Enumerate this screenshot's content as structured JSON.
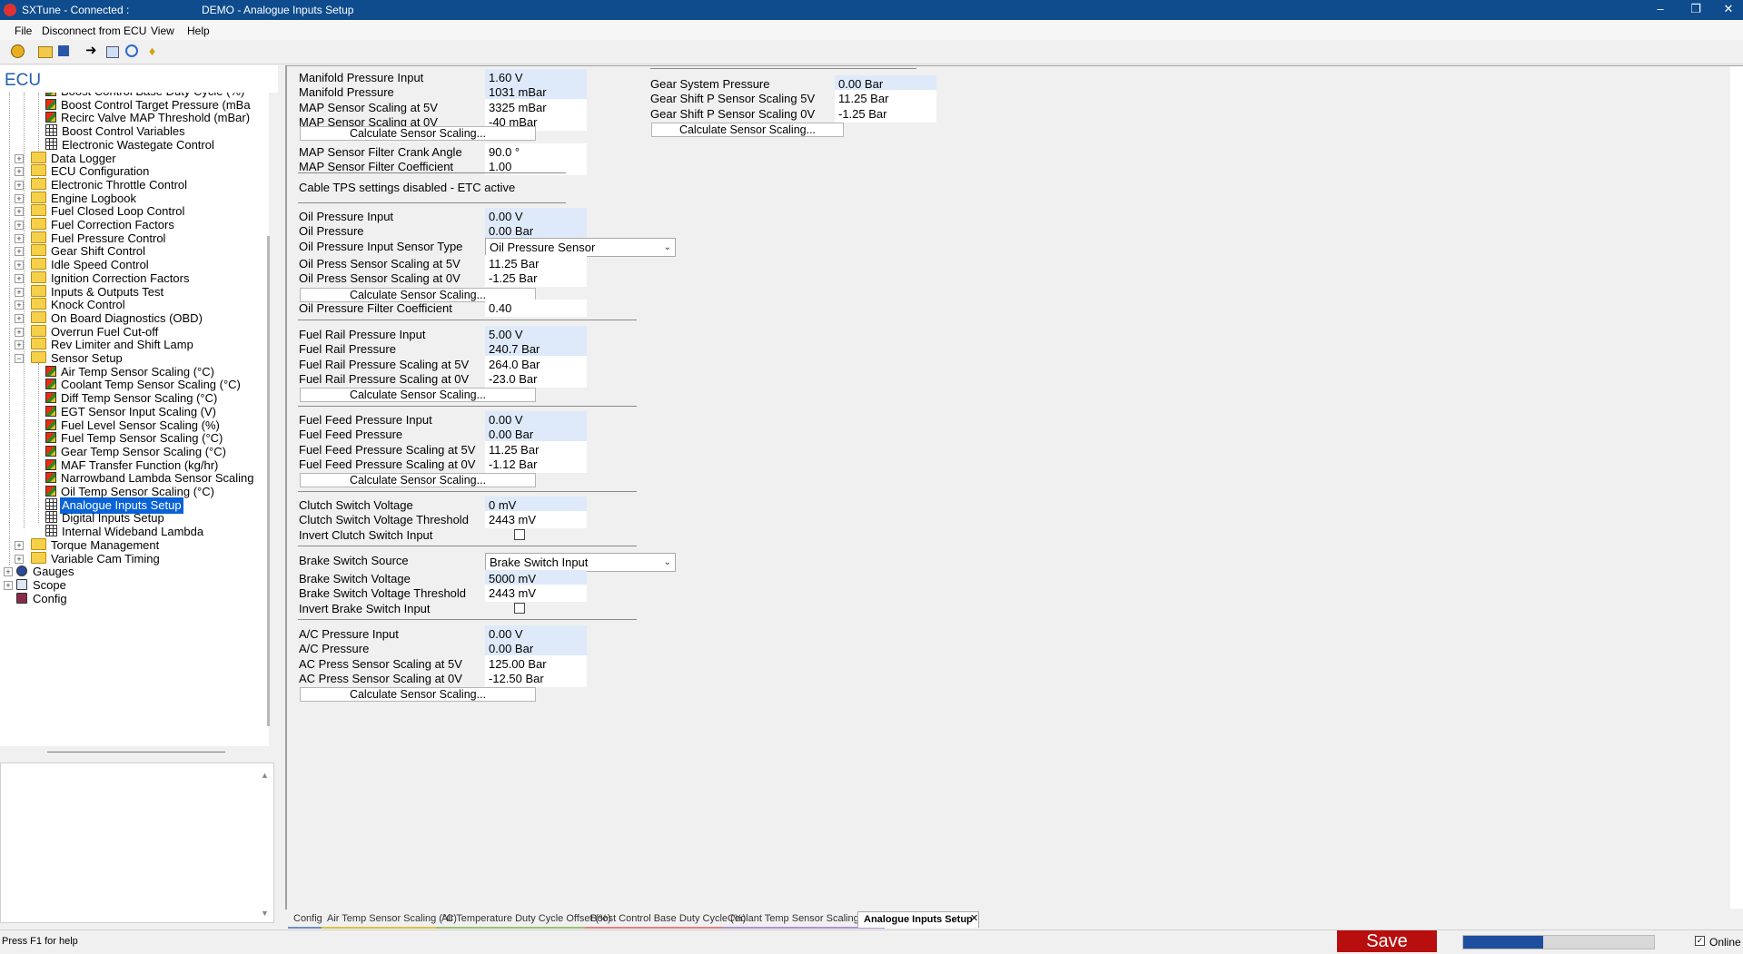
{
  "window": {
    "app_title": "SXTune - Connected :",
    "doc_title": "DEMO - Analogue Inputs Setup",
    "minimize": "‒",
    "restore": "❐",
    "close": "✕"
  },
  "menu": [
    "File",
    "Disconnect from ECU",
    "View",
    "Help"
  ],
  "ecu_header": "ECU",
  "tree": {
    "boost_children": [
      "Boost Control Base Duty Cycle (%)",
      "Boost Control Target Pressure (mBa",
      "Recirc Valve MAP Threshold (mBar)",
      "Boost Control Variables",
      "Electronic Wastegate Control"
    ],
    "folders_top": [
      "Data Logger",
      "ECU Configuration",
      "Electronic Throttle Control",
      "Engine Logbook",
      "Fuel Closed Loop Control",
      "Fuel Correction Factors",
      "Fuel Pressure Control",
      "Gear Shift Control",
      "Idle Speed Control",
      "Ignition Correction Factors",
      "Inputs & Outputs Test",
      "Knock Control",
      "On Board Diagnostics (OBD)",
      "Overrun Fuel Cut-off",
      "Rev Limiter and Shift Lamp",
      "Sensor Setup"
    ],
    "sensor_children": [
      "Air Temp Sensor Scaling (°C)",
      "Coolant Temp Sensor Scaling (°C)",
      "Diff Temp Sensor Scaling (°C)",
      "EGT Sensor Input Scaling (V)",
      "Fuel Level Sensor Scaling (%)",
      "Fuel Temp Sensor Scaling (°C)",
      "Gear Temp Sensor Scaling (°C)",
      "MAF Transfer Function (kg/hr)",
      "Narrowband Lambda Sensor Scaling",
      "Oil Temp Sensor Scaling (°C)",
      "Analogue Inputs Setup",
      "Digital Inputs Setup",
      "Internal Wideband Lambda"
    ],
    "folders_bottom": [
      "Torque Management",
      "Variable Cam Timing"
    ],
    "roots": [
      "Gauges",
      "Scope",
      "Config"
    ]
  },
  "form": {
    "calc_button": "Calculate Sensor Scaling...",
    "map": {
      "rows": [
        {
          "label": "Manifold Pressure Input",
          "value": "1.60 V"
        },
        {
          "label": "Manifold Pressure",
          "value": "1031 mBar"
        },
        {
          "label": "MAP Sensor Scaling at 5V",
          "value": "3325 mBar"
        },
        {
          "label": "MAP Sensor Scaling at 0V",
          "value": "-40 mBar"
        }
      ],
      "filter_rows": [
        {
          "label": "MAP Sensor Filter Crank Angle",
          "value": "90.0 °"
        },
        {
          "label": "MAP Sensor Filter Coefficient",
          "value": "1.00"
        }
      ]
    },
    "tps_note": "Cable TPS settings disabled - ETC active",
    "oil": {
      "input": {
        "label": "Oil Pressure Input",
        "value": "0.00 V"
      },
      "pressure": {
        "label": "Oil Pressure",
        "value": "0.00 Bar"
      },
      "sensor_type": {
        "label": "Oil Pressure Input Sensor Type",
        "value": "Oil Pressure Sensor"
      },
      "scale5": {
        "label": "Oil Press Sensor Scaling at 5V",
        "value": "11.25 Bar"
      },
      "scale0": {
        "label": "Oil Press Sensor Scaling at 0V",
        "value": "-1.25 Bar"
      },
      "filter": {
        "label": "Oil Pressure Filter Coefficient",
        "value": "0.40"
      }
    },
    "fuel_rail": {
      "rows": [
        {
          "label": "Fuel Rail Pressure Input",
          "value": "5.00 V"
        },
        {
          "label": "Fuel Rail Pressure",
          "value": "240.7 Bar"
        },
        {
          "label": "Fuel Rail Pressure Scaling at 5V",
          "value": "264.0 Bar"
        },
        {
          "label": "Fuel Rail Pressure Scaling at 0V",
          "value": "-23.0 Bar"
        }
      ]
    },
    "fuel_feed": {
      "rows": [
        {
          "label": "Fuel Feed Pressure Input",
          "value": "0.00 V"
        },
        {
          "label": "Fuel Feed Pressure",
          "value": "0.00 Bar"
        },
        {
          "label": "Fuel Feed Pressure Scaling at 5V",
          "value": "11.25 Bar"
        },
        {
          "label": "Fuel Feed Pressure Scaling at 0V",
          "value": "-1.12 Bar"
        }
      ]
    },
    "clutch": {
      "voltage": {
        "label": "Clutch Switch Voltage",
        "value": "0 mV"
      },
      "threshold": {
        "label": "Clutch Switch Voltage Threshold",
        "value": "2443 mV"
      },
      "invert": {
        "label": "Invert Clutch Switch Input"
      }
    },
    "brake": {
      "source": {
        "label": "Brake Switch Source",
        "value": "Brake Switch Input"
      },
      "voltage": {
        "label": "Brake Switch Voltage",
        "value": "5000 mV"
      },
      "threshold": {
        "label": "Brake Switch Voltage Threshold",
        "value": "2443 mV"
      },
      "invert": {
        "label": "Invert Brake Switch Input"
      }
    },
    "ac": {
      "rows": [
        {
          "label": "A/C Pressure Input",
          "value": "0.00 V"
        },
        {
          "label": "A/C Pressure",
          "value": "0.00 Bar"
        },
        {
          "label": "AC Press Sensor Scaling at 5V",
          "value": "125.00 Bar"
        },
        {
          "label": "AC Press Sensor Scaling at 0V",
          "value": "-12.50 Bar"
        }
      ]
    },
    "gear": {
      "rows": [
        {
          "label": "Gear System Pressure",
          "value": "0.00 Bar"
        },
        {
          "label": "Gear Shift P Sensor Scaling 5V",
          "value": "11.25 Bar"
        },
        {
          "label": "Gear Shift P Sensor Scaling 0V",
          "value": "-1.25 Bar"
        }
      ]
    }
  },
  "tabs": [
    {
      "label": "Config",
      "color": "#6f8fbf"
    },
    {
      "label": "Air Temp Sensor Scaling (°C)",
      "color": "#e0c040"
    },
    {
      "label": "Air Temperature Duty Cycle Offset (%)",
      "color": "#9ac070"
    },
    {
      "label": "Boost Control Base Duty Cycle (%)",
      "color": "#e08080"
    },
    {
      "label": "Coolant Temp Sensor Scaling (°C)",
      "color": "#b090d0"
    },
    {
      "label": "Analogue Inputs Setup",
      "color": "#000000"
    }
  ],
  "tab_close": "✕",
  "status": {
    "help": "Press F1 for help",
    "save": "Save",
    "online": "Online",
    "progress": 0.42
  },
  "colors": {
    "accent": "#0e4c8e",
    "save": "#b80e0e",
    "readonly_field": "#deeafa"
  }
}
